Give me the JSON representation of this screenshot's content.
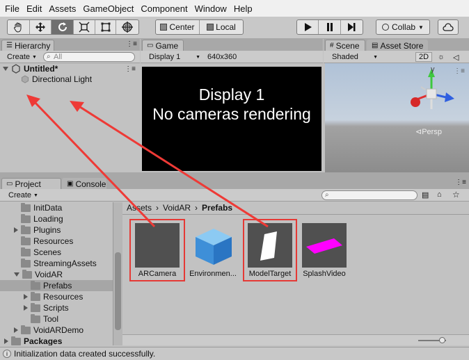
{
  "menu": [
    "File",
    "Edit",
    "Assets",
    "GameObject",
    "Component",
    "Window",
    "Help"
  ],
  "toolbar": {
    "tools": [
      "hand-tool",
      "move-tool",
      "rotate-tool",
      "scale-tool",
      "rect-tool",
      "transform-tool"
    ],
    "pivot_label": "Center",
    "space_label": "Local",
    "collab_label": "Collab"
  },
  "hierarchy": {
    "tab_label": "Hierarchy",
    "create_label": "Create",
    "search_placeholder": "All",
    "scene_name": "Untitled*",
    "items": [
      "Directional Light"
    ]
  },
  "game": {
    "tab_label": "Game",
    "display_label": "Display 1",
    "resolution_label": "640x360",
    "message_line1": "Display 1",
    "message_line2": "No cameras rendering"
  },
  "scene": {
    "tab_label": "Scene",
    "asset_store_label": "Asset Store",
    "shading_label": "Shaded",
    "mode_2d_label": "2D",
    "gizmo_y": "y",
    "persp_label": "Persp"
  },
  "project": {
    "tab_label": "Project",
    "console_label": "Console",
    "create_label": "Create",
    "tree": [
      {
        "label": "InitData",
        "indent": 1,
        "arrow": "none"
      },
      {
        "label": "Loading",
        "indent": 1,
        "arrow": "none"
      },
      {
        "label": "Plugins",
        "indent": 1,
        "arrow": "right"
      },
      {
        "label": "Resources",
        "indent": 1,
        "arrow": "none"
      },
      {
        "label": "Scenes",
        "indent": 1,
        "arrow": "none"
      },
      {
        "label": "StreamingAssets",
        "indent": 1,
        "arrow": "none"
      },
      {
        "label": "VoidAR",
        "indent": 1,
        "arrow": "down"
      },
      {
        "label": "Prefabs",
        "indent": 2,
        "arrow": "none",
        "selected": true
      },
      {
        "label": "Resources",
        "indent": 2,
        "arrow": "right"
      },
      {
        "label": "Scripts",
        "indent": 2,
        "arrow": "right"
      },
      {
        "label": "Tool",
        "indent": 2,
        "arrow": "none"
      },
      {
        "label": "VoidARDemo",
        "indent": 1,
        "arrow": "right"
      },
      {
        "label": "Packages",
        "indent": 0,
        "arrow": "right",
        "bold": true
      }
    ],
    "breadcrumb": [
      "Assets",
      "VoidAR",
      "Prefabs"
    ],
    "assets": [
      {
        "label": "ARCamera",
        "highlighted": true
      },
      {
        "label": "Environmen...",
        "highlighted": false
      },
      {
        "label": "ModelTarget",
        "highlighted": true
      },
      {
        "label": "SplashVideo",
        "highlighted": false
      }
    ]
  },
  "status": {
    "message": "Initialization data created successfully."
  },
  "colors": {
    "highlight_red": "#e53935",
    "arrow_red": "#ee3a36",
    "selected_row": "#a6a6a6",
    "game_bg": "#000000"
  }
}
